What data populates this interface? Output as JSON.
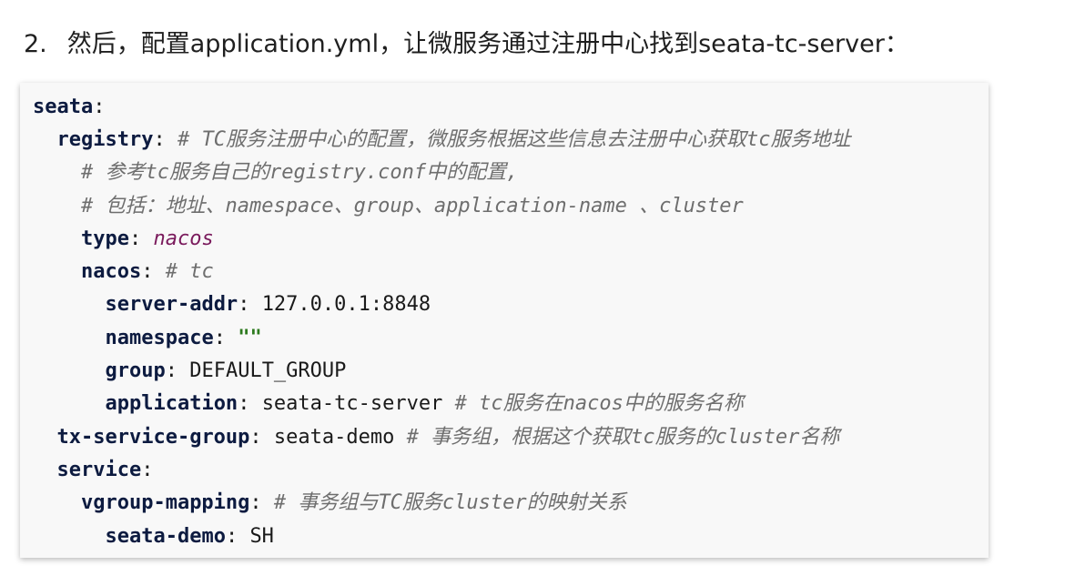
{
  "heading": {
    "number": "2.",
    "text": "然后，配置application.yml，让微服务通过注册中心找到seata-tc-server："
  },
  "code": {
    "lines": [
      {
        "key": "seata",
        "sep": ":",
        "value": "",
        "comment": ""
      },
      {
        "key": "registry",
        "sep": ":",
        "value": "",
        "comment": "# TC服务注册中心的配置，微服务根据这些信息去注册中心获取tc服务地址"
      },
      {
        "key": "",
        "sep": "",
        "value": "",
        "comment": "# 参考tc服务自己的registry.conf中的配置,"
      },
      {
        "key": "",
        "sep": "",
        "value": "",
        "comment": "# 包括：地址、namespace、group、application-name 、cluster"
      },
      {
        "key": "type",
        "sep": ":",
        "value": "nacos",
        "comment": ""
      },
      {
        "key": "nacos",
        "sep": ":",
        "value": "",
        "comment": "# tc"
      },
      {
        "key": "server-addr",
        "sep": ":",
        "value": "127.0.0.1:8848",
        "comment": ""
      },
      {
        "key": "namespace",
        "sep": ":",
        "value": "\"\"",
        "comment": ""
      },
      {
        "key": "group",
        "sep": ":",
        "value": "DEFAULT_GROUP",
        "comment": ""
      },
      {
        "key": "application",
        "sep": ":",
        "value": "seata-tc-server",
        "comment": "# tc服务在nacos中的服务名称"
      },
      {
        "key": "tx-service-group",
        "sep": ":",
        "value": "seata-demo",
        "comment": "# 事务组，根据这个获取tc服务的cluster名称"
      },
      {
        "key": "service",
        "sep": ":",
        "value": "",
        "comment": ""
      },
      {
        "key": "vgroup-mapping",
        "sep": ":",
        "value": "",
        "comment": "# 事务组与TC服务cluster的映射关系"
      },
      {
        "key": "seata-demo",
        "sep": ":",
        "value": "SH",
        "comment": ""
      }
    ]
  }
}
